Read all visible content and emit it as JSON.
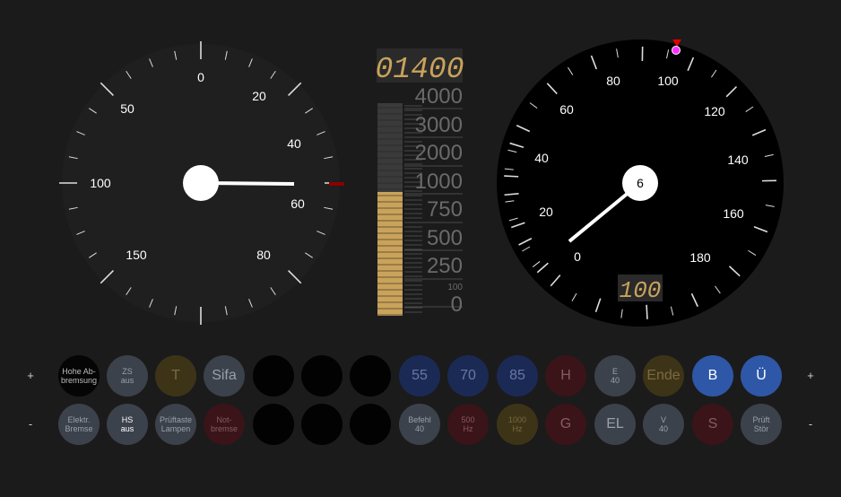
{
  "brake_gauge": {
    "scale_labels": [
      "0",
      "20",
      "40",
      "60",
      "80",
      "100",
      "150",
      "50"
    ],
    "needle_value": 60
  },
  "lzb_display": {
    "target_distance_digital": "01400",
    "bar_scale_labels": [
      "4000",
      "3000",
      "2000",
      "1000",
      "750",
      "500",
      "250",
      "100",
      "0"
    ],
    "bar_fill_value": 1000
  },
  "speedometer": {
    "scale_labels": [
      "0",
      "20",
      "40",
      "60",
      "80",
      "100",
      "120",
      "140",
      "160",
      "180"
    ],
    "center_value": "6",
    "target_speed_digital": "100",
    "current_speed": 6,
    "target_speed": 100
  },
  "side_buttons": {
    "plus": "+",
    "minus": "-"
  },
  "row1": [
    {
      "label": "Hohe Ab-\nbremsung",
      "bg": "#050505",
      "fg": "#bdbdbd",
      "size": "small"
    },
    {
      "label": "ZS\naus",
      "bg": "#3c424b",
      "fg": "#9aa0a8",
      "size": "small"
    },
    {
      "label": "T",
      "bg": "#3d3418",
      "fg": "#7a6a3e",
      "size": "big"
    },
    {
      "label": "Sifa",
      "bg": "#3c424b",
      "fg": "#9aa0a8",
      "size": "big"
    },
    {
      "label": "",
      "bg": "#020202",
      "fg": "#000000",
      "size": "big"
    },
    {
      "label": "",
      "bg": "#020202",
      "fg": "#000000",
      "size": "big"
    },
    {
      "label": "",
      "bg": "#020202",
      "fg": "#000000",
      "size": "big"
    },
    {
      "label": "55",
      "bg": "#1b2a55",
      "fg": "#6478a8",
      "size": "big"
    },
    {
      "label": "70",
      "bg": "#1b2a55",
      "fg": "#6478a8",
      "size": "big"
    },
    {
      "label": "85",
      "bg": "#1b2a55",
      "fg": "#6478a8",
      "size": "big"
    },
    {
      "label": "H",
      "bg": "#3a1418",
      "fg": "#8a5a5e",
      "size": "big"
    },
    {
      "label": "E\n40",
      "bg": "#3c424b",
      "fg": "#9aa0a8",
      "size": "small"
    },
    {
      "label": "Ende",
      "bg": "#3d3418",
      "fg": "#7a6a3e",
      "size": "big"
    },
    {
      "label": "B",
      "bg": "#2e57a8",
      "fg": "#ffffff",
      "size": "big"
    },
    {
      "label": "Ü",
      "bg": "#2e57a8",
      "fg": "#ffffff",
      "size": "big"
    }
  ],
  "row2": [
    {
      "label": "Elektr.\nBremse",
      "bg": "#3c424b",
      "fg": "#9aa0a8",
      "size": "small"
    },
    {
      "label": "HS\naus",
      "bg": "#3c424b",
      "fg": "#ffffff",
      "size": "small"
    },
    {
      "label": "Prüftaste\nLampen",
      "bg": "#3c424b",
      "fg": "#9aa0a8",
      "size": "small"
    },
    {
      "label": "Not-\nbremse",
      "bg": "#3a1418",
      "fg": "#8a5a5e",
      "size": "small"
    },
    {
      "label": "",
      "bg": "#020202",
      "fg": "#000000",
      "size": "big"
    },
    {
      "label": "",
      "bg": "#020202",
      "fg": "#000000",
      "size": "big"
    },
    {
      "label": "",
      "bg": "#020202",
      "fg": "#000000",
      "size": "big"
    },
    {
      "label": "Befehl\n40",
      "bg": "#3c424b",
      "fg": "#9aa0a8",
      "size": "small"
    },
    {
      "label": "500\nHz",
      "bg": "#3a1418",
      "fg": "#8a5a5e",
      "size": "small"
    },
    {
      "label": "1000\nHz",
      "bg": "#3d3418",
      "fg": "#7a6a3e",
      "size": "small"
    },
    {
      "label": "G",
      "bg": "#3a1418",
      "fg": "#8a5a5e",
      "size": "big"
    },
    {
      "label": "EL",
      "bg": "#3c424b",
      "fg": "#9aa0a8",
      "size": "big"
    },
    {
      "label": "V\n40",
      "bg": "#3c424b",
      "fg": "#9aa0a8",
      "size": "small"
    },
    {
      "label": "S",
      "bg": "#3a1418",
      "fg": "#8a5a5e",
      "size": "big"
    },
    {
      "label": "Prüft\nStör",
      "bg": "#3c424b",
      "fg": "#9aa0a8",
      "size": "small"
    }
  ]
}
